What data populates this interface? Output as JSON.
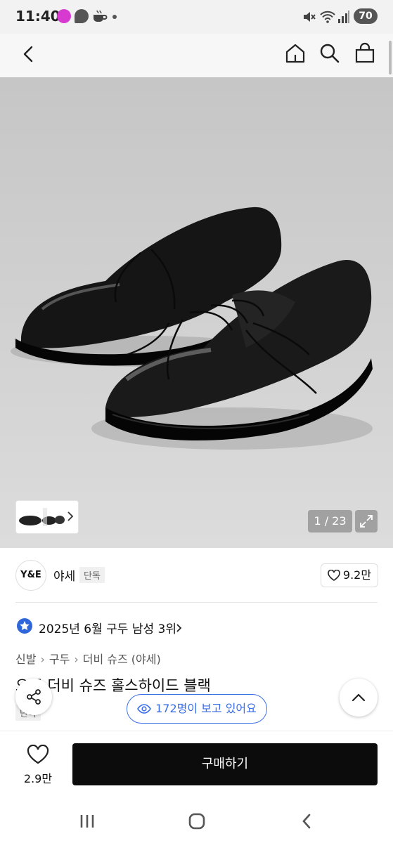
{
  "status_bar": {
    "time": "11:40",
    "battery": "70",
    "icons": [
      "shopping-app-icon",
      "talk-icon",
      "cafe-icon",
      "dot-icon",
      "mute-icon",
      "wifi-icon",
      "signal-icon"
    ]
  },
  "top_nav": {
    "icons": [
      "back-icon",
      "home-icon",
      "search-icon",
      "shopping-bag-icon"
    ]
  },
  "gallery": {
    "counter": "1 / 23"
  },
  "store": {
    "logo_text": "Y&E",
    "name": "야세",
    "badge": "단독",
    "likes": "9.2만"
  },
  "ranking": {
    "text": "2025년 6월 구두 남성 3위"
  },
  "breadcrumb": [
    "신발",
    "구두",
    "더비 슈즈 (야세)"
  ],
  "product": {
    "title": "오픈 더비 슈즈 홀스하이드 블랙",
    "badge": "단독"
  },
  "viewers": "172명이 보고 있어요",
  "bottom_bar": {
    "wish_count": "2.9만",
    "buy_label": "구매하기"
  },
  "colors": {
    "accent_blue": "#3a6ee8",
    "buy_button": "#0c0c0c",
    "rank_badge": "#2f66d9"
  }
}
